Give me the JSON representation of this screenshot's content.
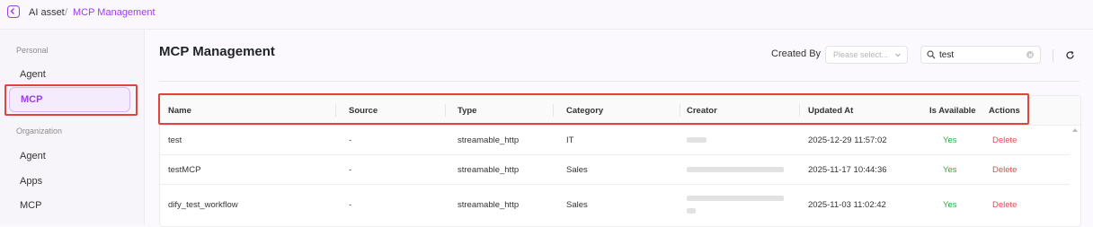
{
  "breadcrumb": {
    "parent": "AI asset",
    "separator": "/",
    "current": "MCP Management"
  },
  "sidebar": {
    "personal_label": "Personal",
    "personal_items": [
      "Agent",
      "MCP"
    ],
    "org_label": "Organization",
    "org_items": [
      "Agent",
      "Apps",
      "MCP"
    ]
  },
  "page": {
    "title": "MCP Management"
  },
  "filters": {
    "created_by_label": "Created By",
    "created_by_placeholder": "Please select...",
    "search_value": "test"
  },
  "table": {
    "columns": [
      "Name",
      "Source",
      "Type",
      "Category",
      "Creator",
      "Updated At",
      "Is Available",
      "Actions"
    ],
    "rows": [
      {
        "name": "test",
        "source": "-",
        "type": "streamable_http",
        "category": "IT",
        "updated_at": "2025-12-29 11:57:02",
        "available": "Yes",
        "action": "Delete"
      },
      {
        "name": "testMCP",
        "source": "-",
        "type": "streamable_http",
        "category": "Sales",
        "updated_at": "2025-11-17 10:44:36",
        "available": "Yes",
        "action": "Delete"
      },
      {
        "name": "dify_test_workflow",
        "source": "-",
        "type": "streamable_http",
        "category": "Sales",
        "updated_at": "2025-11-03 11:02:42",
        "available": "Yes",
        "action": "Delete"
      }
    ]
  },
  "colors": {
    "accent": "#9b3ee8",
    "highlight": "#e0443c",
    "available": "#2cae3d",
    "delete": "#e64a4a"
  },
  "icons": [
    "back-icon",
    "chevron-down-icon",
    "search-icon",
    "clear-icon",
    "refresh-icon",
    "scroll-up-icon"
  ]
}
